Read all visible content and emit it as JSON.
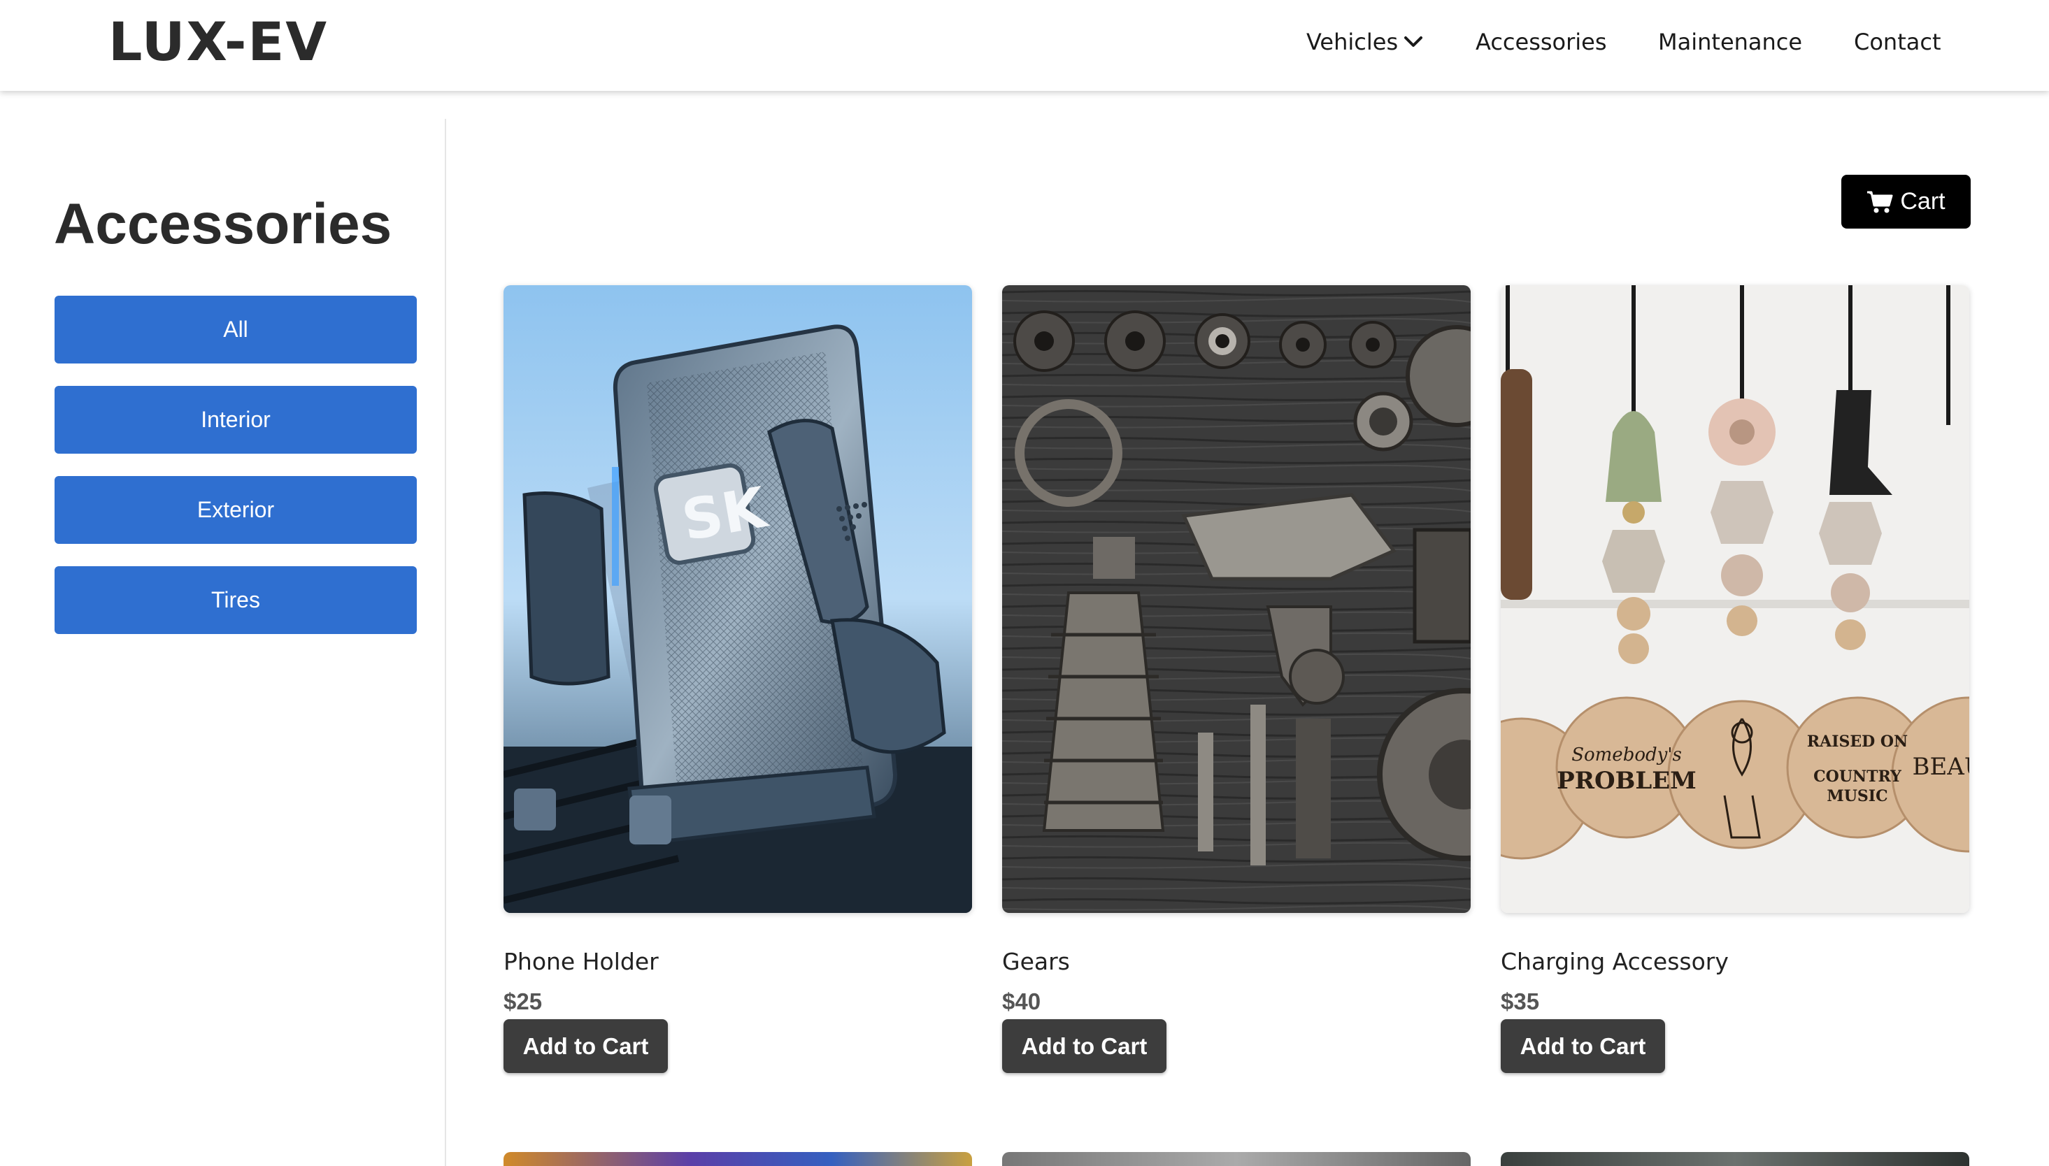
{
  "header": {
    "logo": "LUX-EV",
    "nav": [
      {
        "label": "Vehicles",
        "icon": "chevron-down-icon"
      },
      {
        "label": "Accessories"
      },
      {
        "label": "Maintenance"
      },
      {
        "label": "Contact"
      }
    ]
  },
  "sidebar": {
    "title": "Accessories",
    "filters": [
      "All",
      "Interior",
      "Exterior",
      "Tires"
    ]
  },
  "cart": {
    "label": "Cart",
    "icon": "cart-icon"
  },
  "products": [
    {
      "name": "Phone Holder",
      "price": "$25",
      "button": "Add to Cart",
      "image": "phone-holder-photo"
    },
    {
      "name": "Gears",
      "price": "$40",
      "button": "Add to Cart",
      "image": "gears-photo"
    },
    {
      "name": "Charging Accessory",
      "price": "$35",
      "button": "Add to Cart",
      "image": "charging-accessory-photo"
    }
  ],
  "colors": {
    "filter_button": "#2f6fd0",
    "add_to_cart": "#3d3d3d",
    "cart_button": "#000000",
    "logo": "#2b2b2b"
  }
}
